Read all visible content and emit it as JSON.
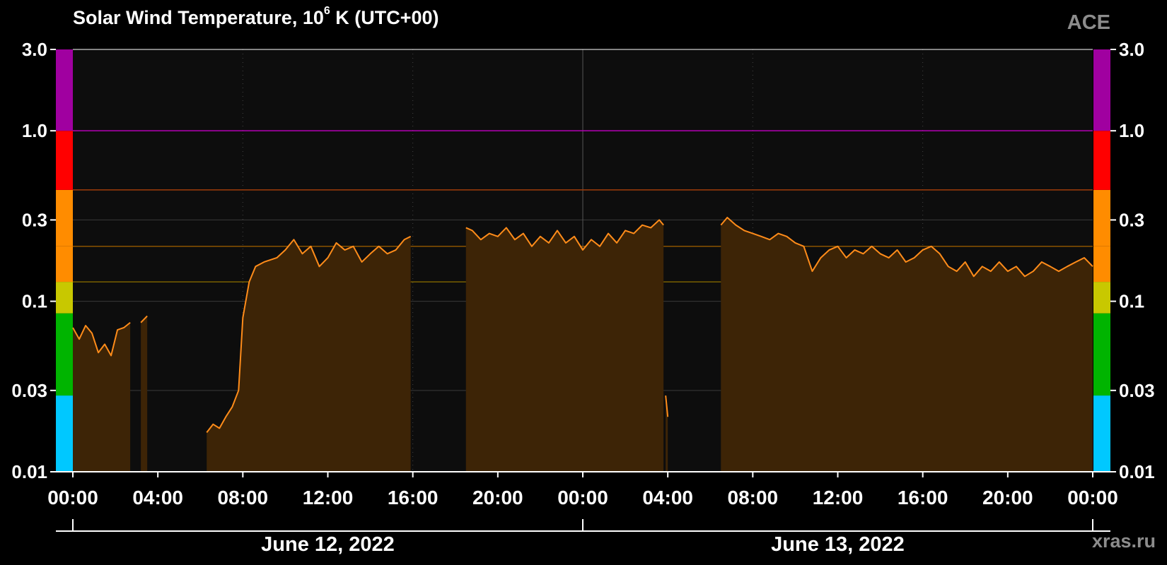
{
  "title_prefix": "Solar Wind Temperature, 10",
  "title_exp": "6",
  "title_suffix": " K (UTC+00)",
  "source_label": "ACE",
  "watermark": "xras.ru",
  "colors": {
    "background": "#000000",
    "plot_bg": "#0d0d0d",
    "line": "#ff8c1a",
    "fill": "#3d2406",
    "grid": "#3a3a3a"
  },
  "chart_data": {
    "type": "area",
    "y_scale": "log",
    "ylim": [
      0.01,
      3.0
    ],
    "y_ticks": [
      {
        "value": 3.0,
        "label": "3.0"
      },
      {
        "value": 1.0,
        "label": "1.0"
      },
      {
        "value": 0.3,
        "label": "0.3"
      },
      {
        "value": 0.1,
        "label": "0.1"
      },
      {
        "value": 0.03,
        "label": "0.03"
      },
      {
        "value": 0.01,
        "label": "0.01"
      }
    ],
    "x_unit": "hours since 2022-06-12 00:00 UTC",
    "xlim": [
      0,
      48
    ],
    "x_ticks": [
      {
        "value": 0,
        "label": "00:00"
      },
      {
        "value": 4,
        "label": "04:00"
      },
      {
        "value": 8,
        "label": "08:00"
      },
      {
        "value": 12,
        "label": "12:00"
      },
      {
        "value": 16,
        "label": "16:00"
      },
      {
        "value": 20,
        "label": "20:00"
      },
      {
        "value": 24,
        "label": "00:00"
      },
      {
        "value": 28,
        "label": "04:00"
      },
      {
        "value": 32,
        "label": "08:00"
      },
      {
        "value": 36,
        "label": "12:00"
      },
      {
        "value": 40,
        "label": "16:00"
      },
      {
        "value": 44,
        "label": "20:00"
      },
      {
        "value": 48,
        "label": "00:00"
      }
    ],
    "date_labels": [
      {
        "center": 12,
        "label": "June 12, 2022"
      },
      {
        "center": 36,
        "label": "June 13, 2022"
      }
    ],
    "threshold_bands": [
      {
        "from": 0.01,
        "to": 0.028,
        "color": "#00c8ff"
      },
      {
        "from": 0.028,
        "to": 0.085,
        "color": "#00b400"
      },
      {
        "from": 0.085,
        "to": 0.13,
        "color": "#c8c800"
      },
      {
        "from": 0.13,
        "to": 0.21,
        "color": "#ff8c00"
      },
      {
        "from": 0.21,
        "to": 0.45,
        "color": "#ff8c00"
      },
      {
        "from": 0.45,
        "to": 1.0,
        "color": "#ff0000"
      },
      {
        "from": 1.0,
        "to": 3.0,
        "color": "#a000a0"
      }
    ],
    "threshold_lines": [
      {
        "value": 1.0,
        "color": "#b400b4"
      },
      {
        "value": 0.45,
        "color": "#a03c0a"
      },
      {
        "value": 0.21,
        "color": "#8a5200"
      },
      {
        "value": 0.13,
        "color": "#7a6000"
      }
    ],
    "segments": [
      {
        "x": [
          0.0,
          0.3,
          0.6,
          0.9,
          1.2,
          1.5,
          1.8,
          2.1,
          2.4,
          2.7
        ],
        "y": [
          0.07,
          0.06,
          0.072,
          0.065,
          0.05,
          0.056,
          0.048,
          0.068,
          0.07,
          0.075
        ]
      },
      {
        "x": [
          3.2,
          3.5
        ],
        "y": [
          0.075,
          0.082
        ]
      },
      {
        "x": [
          6.3,
          6.6,
          6.9,
          7.2,
          7.5,
          7.8,
          8.0,
          8.3,
          8.6,
          9.0,
          9.3,
          9.6,
          10.0,
          10.4,
          10.8,
          11.2,
          11.6,
          12.0,
          12.4,
          12.8,
          13.2,
          13.6,
          14.0,
          14.4,
          14.8,
          15.2,
          15.6,
          15.9
        ],
        "y": [
          0.017,
          0.019,
          0.018,
          0.021,
          0.024,
          0.03,
          0.08,
          0.13,
          0.16,
          0.17,
          0.175,
          0.18,
          0.2,
          0.23,
          0.19,
          0.21,
          0.16,
          0.18,
          0.22,
          0.2,
          0.21,
          0.17,
          0.19,
          0.21,
          0.19,
          0.2,
          0.23,
          0.24
        ]
      },
      {
        "x": [
          18.5,
          18.8,
          19.2,
          19.6,
          20.0,
          20.4,
          20.8,
          21.2,
          21.6,
          22.0,
          22.4,
          22.8,
          23.2,
          23.6,
          24.0,
          24.4,
          24.8,
          25.2,
          25.6,
          26.0,
          26.4,
          26.8,
          27.2,
          27.6,
          27.8
        ],
        "y": [
          0.27,
          0.26,
          0.23,
          0.25,
          0.24,
          0.27,
          0.23,
          0.25,
          0.21,
          0.24,
          0.22,
          0.26,
          0.22,
          0.24,
          0.2,
          0.23,
          0.21,
          0.25,
          0.22,
          0.26,
          0.25,
          0.28,
          0.27,
          0.3,
          0.28
        ]
      },
      {
        "x": [
          27.9,
          28.0
        ],
        "y": [
          0.028,
          0.021
        ]
      },
      {
        "x": [
          30.5,
          30.8,
          31.2,
          31.6,
          32.0,
          32.4,
          32.8,
          33.2,
          33.6,
          34.0,
          34.4,
          34.8,
          35.2,
          35.6,
          36.0,
          36.4,
          36.8,
          37.2,
          37.6,
          38.0,
          38.4,
          38.8,
          39.2,
          39.6,
          40.0,
          40.4,
          40.8,
          41.2,
          41.6,
          42.0,
          42.4,
          42.8,
          43.2,
          43.6,
          44.0,
          44.4,
          44.8,
          45.2,
          45.6,
          46.0,
          46.4,
          46.8,
          47.2,
          47.6,
          48.0
        ],
        "y": [
          0.28,
          0.31,
          0.28,
          0.26,
          0.25,
          0.24,
          0.23,
          0.25,
          0.24,
          0.22,
          0.21,
          0.15,
          0.18,
          0.2,
          0.21,
          0.18,
          0.2,
          0.19,
          0.21,
          0.19,
          0.18,
          0.2,
          0.17,
          0.18,
          0.2,
          0.21,
          0.19,
          0.16,
          0.15,
          0.17,
          0.14,
          0.16,
          0.15,
          0.17,
          0.15,
          0.16,
          0.14,
          0.15,
          0.17,
          0.16,
          0.15,
          0.16,
          0.17,
          0.18,
          0.16
        ]
      }
    ]
  }
}
